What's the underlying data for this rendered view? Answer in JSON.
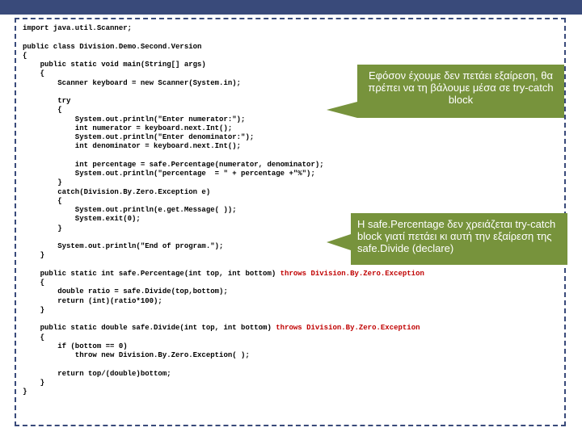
{
  "code": {
    "l1": "import java.util.Scanner;",
    "l2": "",
    "l3": "public class Division.Demo.Second.Version",
    "l4": "{",
    "l5": "    public static void main(String[] args)",
    "l6": "    {",
    "l7": "        Scanner keyboard = new Scanner(System.in);",
    "l8": "",
    "l9": "        try",
    "l10": "        {",
    "l11": "            System.out.println(\"Enter numerator:\");",
    "l12": "            int numerator = keyboard.next.Int();",
    "l13": "            System.out.println(\"Enter denominator:\");",
    "l14": "            int denominator = keyboard.next.Int();",
    "l15": "",
    "l16": "            int percentage = safe.Percentage(numerator, denominator);",
    "l17": "            System.out.println(\"percentage  = \" + percentage +\"%\");",
    "l18": "        }",
    "l19": "        catch(Division.By.Zero.Exception e)",
    "l20": "        {",
    "l21": "            System.out.println(e.get.Message( ));",
    "l22": "            System.exit(0);",
    "l23": "        }",
    "l24": "",
    "l25": "        System.out.println(\"End of program.\");",
    "l26": "    }",
    "l27": "",
    "l28a": "    public static int safe.Percentage(int top, int bottom) ",
    "l28b": "throws Division.By.Zero.Exception",
    "l29": "    {",
    "l30": "        double ratio = safe.Divide(top,bottom);",
    "l31": "        return (int)(ratio*100);",
    "l32": "    }",
    "l33": "",
    "l34a": "    public static double safe.Divide(int top, int bottom) ",
    "l34b": "throws Division.By.Zero.Exception",
    "l35": "    {",
    "l36": "        if (bottom == 0)",
    "l37": "            throw new Division.By.Zero.Exception( );",
    "l38": "",
    "l39": "        return top/(double)bottom;",
    "l40": "    }",
    "l41": "}"
  },
  "callouts": {
    "c1": "Εφόσον έχουμε δεν πετάει εξαίρεση, θα πρέπει να τη βάλουμε μέσα σε try-catch block",
    "c2": "H safe.Percentage δεν χρειάζεται try-catch block γιατί πετάει κι αυτή την εξαίρεση της safe.Divide (declare)"
  }
}
